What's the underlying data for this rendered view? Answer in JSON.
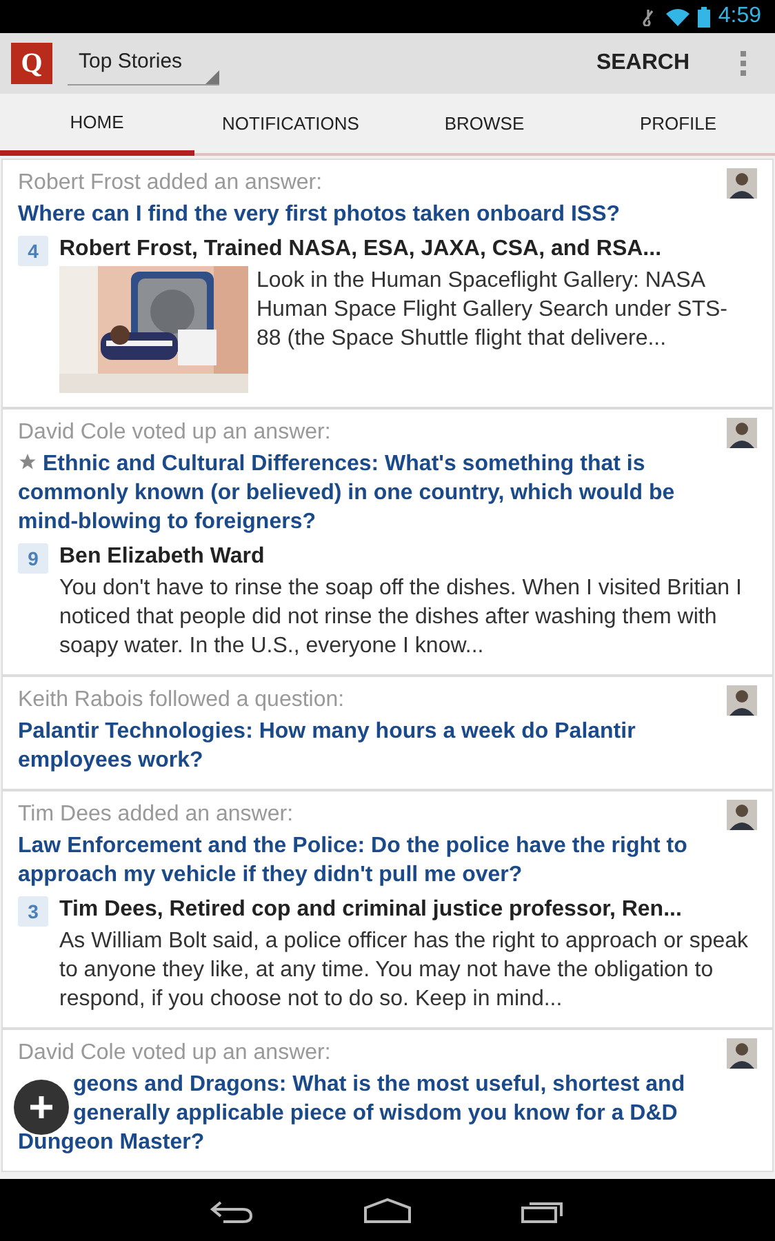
{
  "status_bar": {
    "time": "4:59"
  },
  "action_bar": {
    "logo": "Q",
    "feed_selector": "Top Stories",
    "search": "SEARCH"
  },
  "tabs": [
    {
      "label": "HOME",
      "selected": true
    },
    {
      "label": "NOTIFICATIONS",
      "selected": false
    },
    {
      "label": "BROWSE",
      "selected": false
    },
    {
      "label": "PROFILE",
      "selected": false
    }
  ],
  "feed": [
    {
      "kind": "answer",
      "activity": "Robert Frost added an answer:",
      "question": "Where can I find the very first photos taken onboard ISS?",
      "votes": "4",
      "author": "Robert Frost, Trained NASA, ESA, JAXA, CSA, and RSA...",
      "has_picture": true,
      "answer": "Look in the Human Spaceflight Gallery: NASA Human Space Flight Gallery Search under STS-88 (the Space Shuttle flight that delivere..."
    },
    {
      "kind": "answer",
      "activity": "David Cole voted up an answer:",
      "starred": true,
      "question": "Ethnic and Cultural Differences: What's something that is commonly known (or believed) in one country, which would be mind-blowing to foreigners?",
      "votes": "9",
      "author": "Ben Elizabeth Ward",
      "has_picture": false,
      "answer": "You don't have to rinse the soap off the dishes. When I visited Britian I noticed that people did not rinse the dishes after washing them with soapy water. In the U.S., everyone I know..."
    },
    {
      "kind": "question",
      "activity": "Keith Rabois followed a question:",
      "question": "Palantir Technologies: How many hours a week do Palantir employees work?"
    },
    {
      "kind": "answer",
      "activity": "Tim Dees added an answer:",
      "question": "Law Enforcement and the Police: Do the police have the right to approach my vehicle if they didn't pull me over?",
      "votes": "3",
      "author": "Tim Dees, Retired cop and criminal justice professor, Ren...",
      "has_picture": false,
      "answer": "As William Bolt said, a police officer has the right to approach or speak to anyone they like, at any time. You may not have the obligation to respond, if you choose not to do so. Keep in mind..."
    },
    {
      "kind": "partial_question",
      "activity": "David Cole voted up an answer:",
      "question_lines": [
        {
          "text": "geons and Dragons: What is the most useful, shortest and",
          "covered": true
        },
        {
          "text": "generally applicable piece of wisdom you know for a D&D",
          "covered": true
        },
        {
          "text": "Dungeon Master?",
          "covered": false
        }
      ]
    }
  ]
}
